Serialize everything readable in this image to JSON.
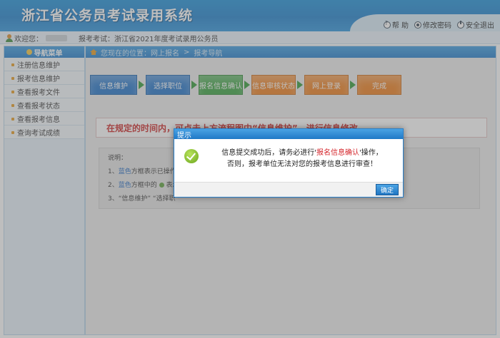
{
  "app": {
    "title": "浙江省公务员考试录用系统"
  },
  "header_links": [
    {
      "label": "帮 助",
      "icon": "help-icon"
    },
    {
      "label": "修改密码",
      "icon": "password-icon"
    },
    {
      "label": "安全退出",
      "icon": "logout-icon"
    }
  ],
  "infobar": {
    "welcome": "欢迎您：",
    "exam": "报考考试：浙江省2021年度考试录用公务员"
  },
  "sidebar": {
    "title": "导航菜单",
    "items": [
      {
        "label": "注册信息维护"
      },
      {
        "label": "报考信息维护"
      },
      {
        "label": "查看报考文件"
      },
      {
        "label": "查看报考状态"
      },
      {
        "label": "查看报考信息"
      },
      {
        "label": "查询考试成绩"
      }
    ]
  },
  "breadcrumb": {
    "prefix": "您现在的位置：网上报名",
    "sep": ">",
    "current": "报考导航"
  },
  "steps": [
    {
      "label": "信息维护",
      "color": "#1e72c9"
    },
    {
      "label": "选择职位",
      "color": "#1e72c9"
    },
    {
      "label": "报名信息确认",
      "color": "#37a23e"
    },
    {
      "label": "信息审核状态",
      "color": "#ee7d1a"
    },
    {
      "label": "网上登录",
      "color": "#ee7d1a"
    },
    {
      "label": "完成",
      "color": "#ee7d1a"
    }
  ],
  "notice": "在规定的时间内，可点击上方流程图中“信息维护”，进行信息修改",
  "notes": {
    "title": "说明：",
    "line1_prefix": "1、",
    "line1_blue": "蓝色",
    "line1_rest": "方框表示已操作，",
    "line2_prefix": "2、",
    "line2_blue": "蓝色",
    "line2_rest": "方框中的",
    "line2_tail": "表示可",
    "line3": "3、“信息维护” “选择职"
  },
  "modal": {
    "title": "提示",
    "text_before": "信息提交成功后，请务必进行'",
    "text_highlight": "报名信息确认",
    "text_after": "'操作，",
    "line2": "否则，报考单位无法对您的报考信息进行审查！",
    "ok": "确定"
  },
  "colors": {
    "header": "#1b7fcd",
    "accent_red": "#d4242a"
  }
}
